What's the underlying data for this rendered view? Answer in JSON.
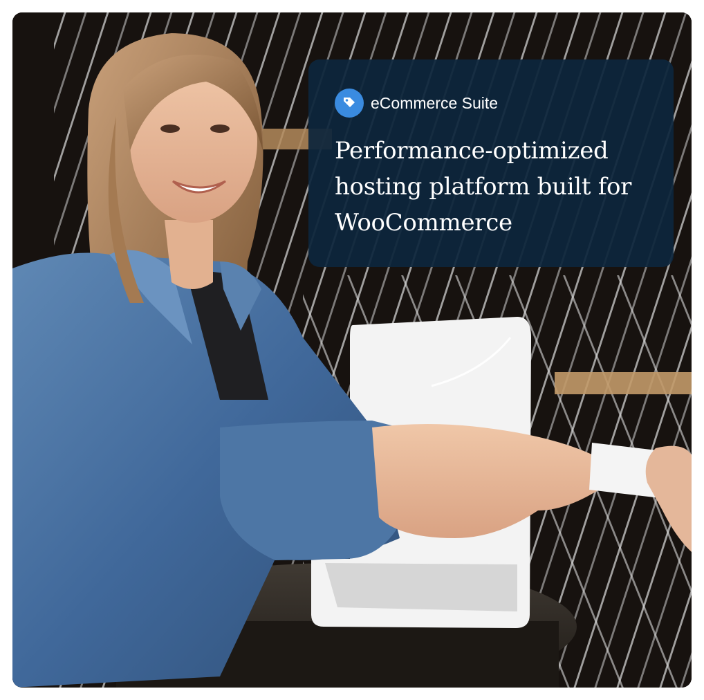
{
  "card": {
    "badge": {
      "icon": "tag-icon",
      "label": "eCommerce Suite"
    },
    "headline": "Performance-optimized hosting platform built for WooCommerce"
  },
  "colors": {
    "overlay": "#0d263c",
    "badge_icon": "#3a8be0",
    "text": "#ffffff"
  },
  "photo": {
    "description_icon": "checkout-photo"
  }
}
